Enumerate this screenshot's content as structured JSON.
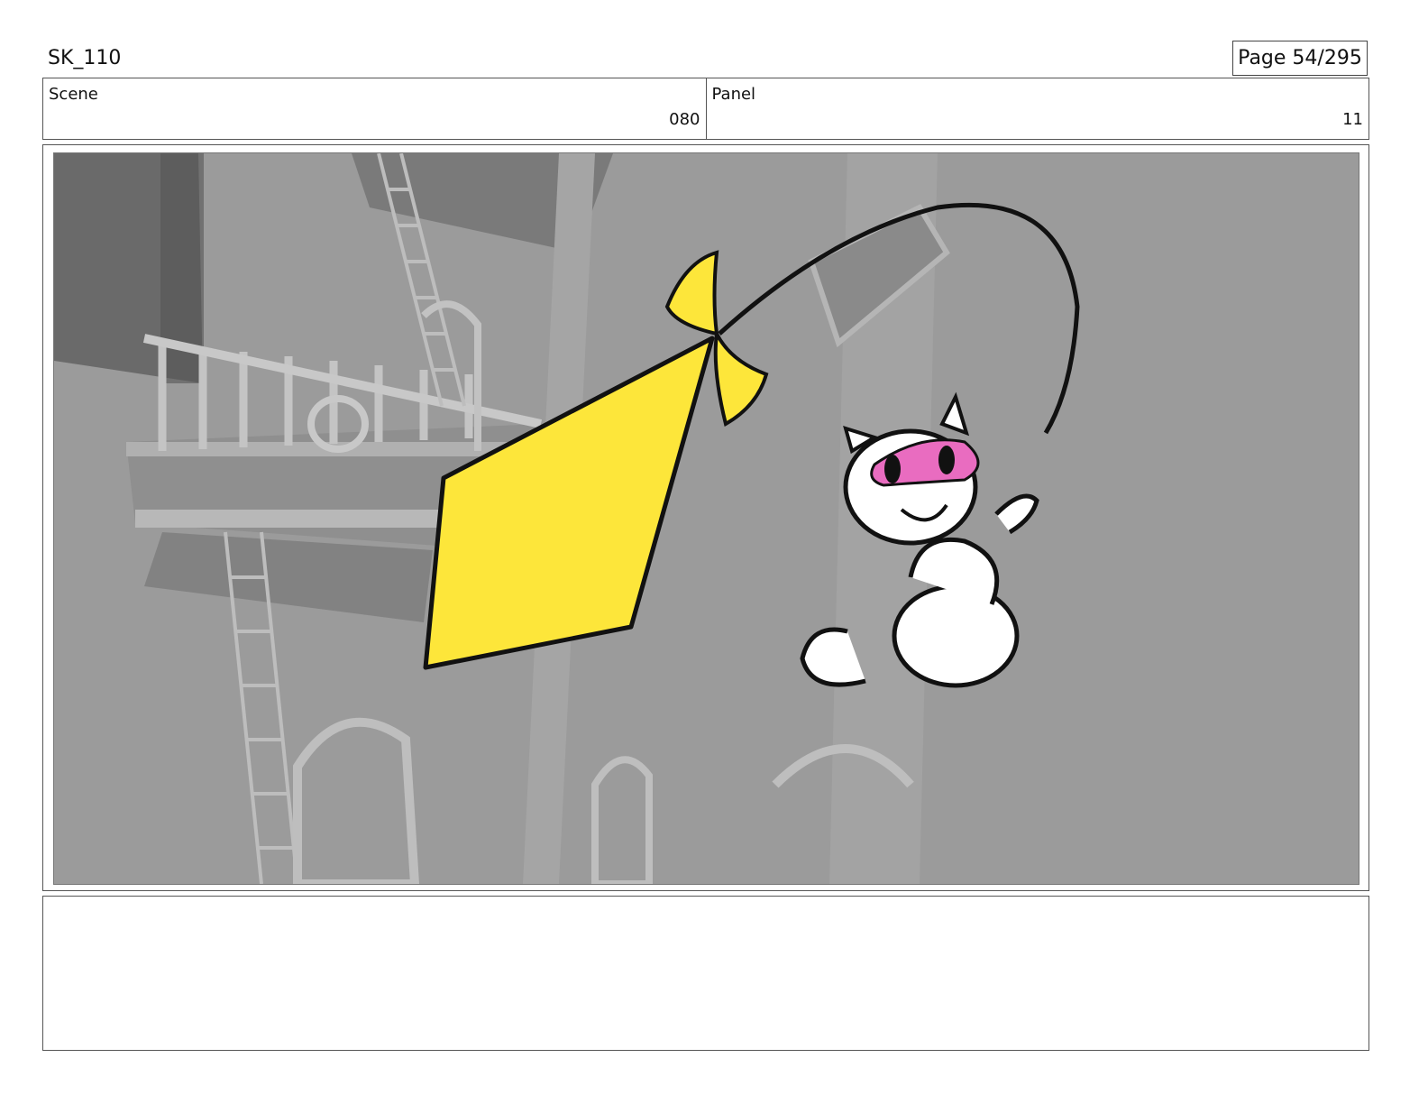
{
  "header": {
    "project_title": "SK_110",
    "page_label": "Page 54/295"
  },
  "info": {
    "scene_label": "Scene",
    "scene_value": "080",
    "panel_label": "Panel",
    "panel_value": "11"
  },
  "panel": {
    "colors": {
      "wall": "#9b9b9b",
      "kite": "#fde63a",
      "mask": "#e96cc0",
      "outline": "#111111",
      "cat": "#ffffff"
    }
  },
  "notes": {
    "text": ""
  }
}
